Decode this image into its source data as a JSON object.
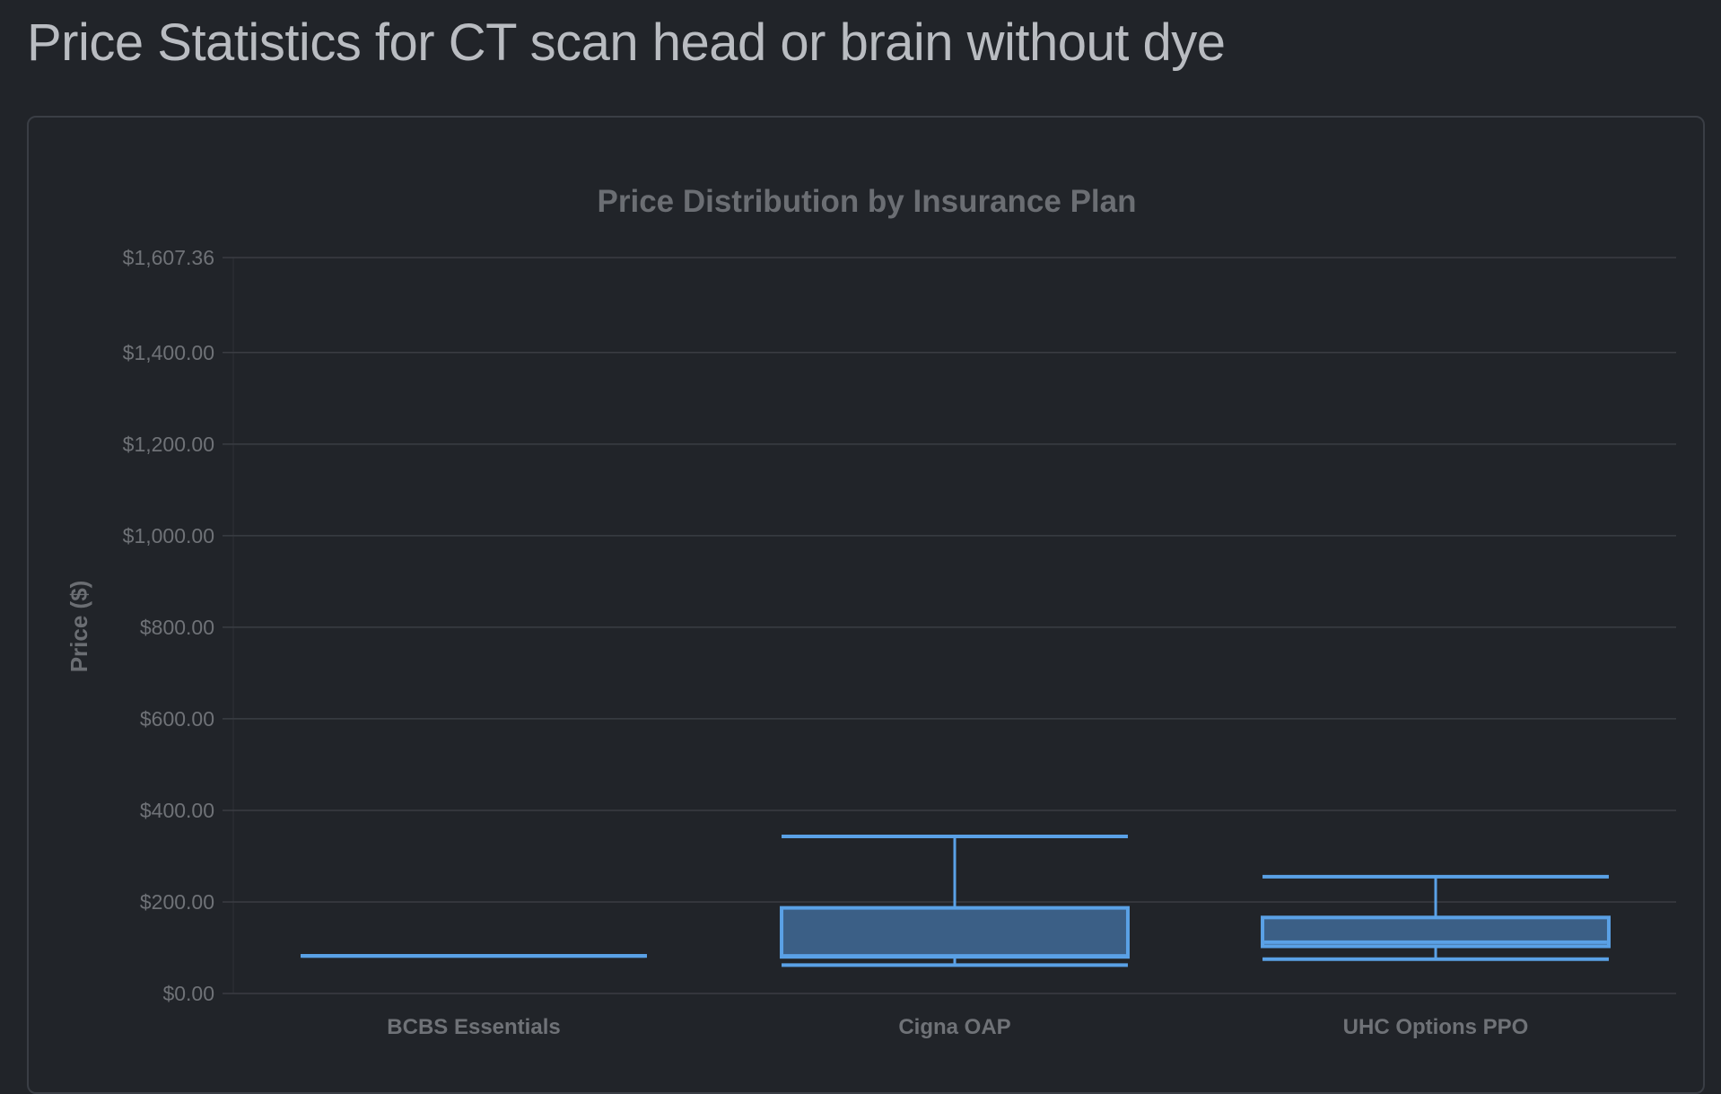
{
  "page": {
    "title": "Price Statistics for CT scan head or brain without dye"
  },
  "colors": {
    "background": "#212429",
    "box_stroke": "#5aa1e6",
    "box_fill": "#3b5f86",
    "median_line_highlight": "#ffffff",
    "grid": "#3a3d43",
    "text_muted": "#6f7277"
  },
  "chart_data": {
    "type": "boxplot",
    "title": "Price Distribution by Insurance Plan",
    "xlabel": "",
    "ylabel": "Price ($)",
    "ylim": [
      0,
      1607.36
    ],
    "y_ticks": [
      0,
      200,
      400,
      600,
      800,
      1000,
      1200,
      1400,
      1607.36
    ],
    "y_tick_labels": [
      "$0.00",
      "$200.00",
      "$400.00",
      "$600.00",
      "$800.00",
      "$1,000.00",
      "$1,200.00",
      "$1,400.00",
      "$1,607.36"
    ],
    "grid": true,
    "legend": "none",
    "categories": [
      "BCBS Essentials",
      "Cigna OAP",
      "UHC Options PPO"
    ],
    "series": [
      {
        "values": [
          {
            "min": 82,
            "q1": 82,
            "median": 82,
            "q3": 82,
            "max": 82
          },
          {
            "min": 62,
            "q1": 80,
            "median": 82,
            "q3": 187,
            "max": 343
          },
          {
            "min": 75,
            "q1": 103,
            "median": 112,
            "q3": 166,
            "max": 255
          }
        ]
      }
    ]
  }
}
